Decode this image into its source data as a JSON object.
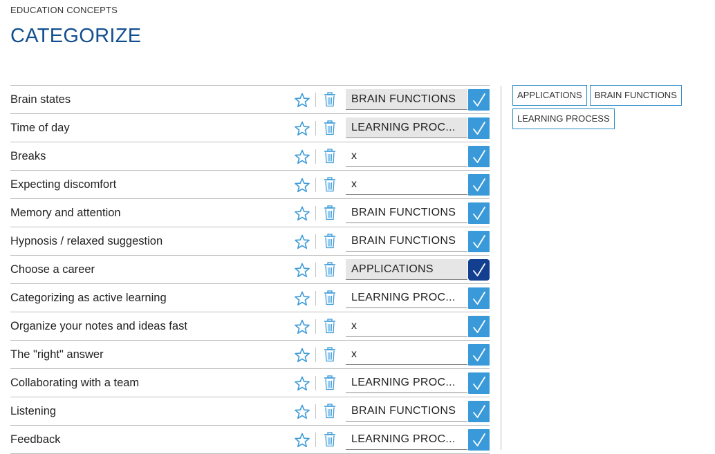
{
  "header": {
    "eyebrow": "EDUCATION CONCEPTS",
    "title": "CATEGORIZE"
  },
  "colors": {
    "title": "#124f90",
    "check_button": "#3a9ad9",
    "check_button_active": "#123f8f",
    "icon": "#3a9ad9"
  },
  "icons": {
    "favorite": "star-icon",
    "delete": "trash-icon",
    "confirm": "checkmark-icon"
  },
  "items": [
    {
      "label": "Brain states",
      "category": "BRAIN FUNCTIONS",
      "filled": true,
      "active": false
    },
    {
      "label": "Time of day",
      "category": "LEARNING  PROC...",
      "filled": true,
      "active": false
    },
    {
      "label": "Breaks",
      "category": "x",
      "filled": false,
      "active": false
    },
    {
      "label": "Expecting discomfort",
      "category": "x",
      "filled": false,
      "active": false
    },
    {
      "label": "Memory and attention",
      "category": "BRAIN FUNCTIONS",
      "filled": false,
      "active": false
    },
    {
      "label": "Hypnosis / relaxed suggestion",
      "category": "BRAIN FUNCTIONS",
      "filled": false,
      "active": false
    },
    {
      "label": "Choose a career",
      "category": "APPLICATIONS",
      "filled": true,
      "active": true
    },
    {
      "label": "Categorizing as active learning",
      "category": "LEARNING  PROC...",
      "filled": false,
      "active": false
    },
    {
      "label": "Organize your notes and ideas fast",
      "category": "x",
      "filled": false,
      "active": false
    },
    {
      "label": "The \"right\" answer",
      "category": "x",
      "filled": false,
      "active": false
    },
    {
      "label": "Collaborating with a team",
      "category": "LEARNING  PROC...",
      "filled": false,
      "active": false
    },
    {
      "label": "Listening",
      "category": "BRAIN FUNCTIONS",
      "filled": false,
      "active": false
    },
    {
      "label": "Feedback",
      "category": "LEARNING  PROC...",
      "filled": false,
      "active": false
    }
  ],
  "categories": [
    {
      "label": "APPLICATIONS"
    },
    {
      "label": "BRAIN FUNCTIONS"
    },
    {
      "label": "LEARNING PROCESS"
    }
  ]
}
